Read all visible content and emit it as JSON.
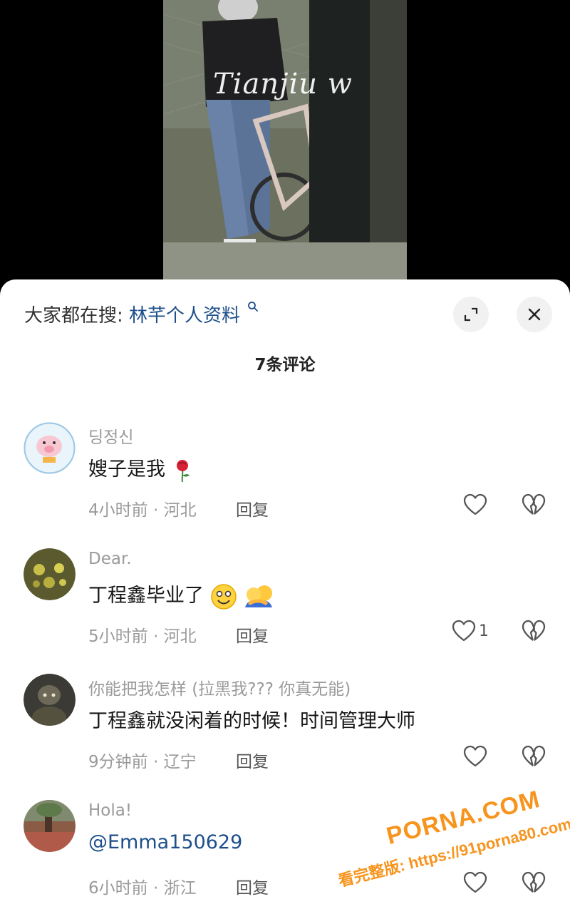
{
  "video": {
    "watermark": "Tianjiu w"
  },
  "sheet": {
    "search": {
      "prefix": "大家都在搜:",
      "query": "林芊个人资料"
    },
    "count_label": "7条评论",
    "reply_label": "回复",
    "comments": [
      {
        "username": "딩정신",
        "text": "嫂子是我",
        "emoji": "rose",
        "time": "4小时前 · 河北",
        "likes": ""
      },
      {
        "username": "Dear.",
        "text": "丁程鑫毕业了",
        "emoji": "smile, hug",
        "time": "5小时前 · 河北",
        "likes": "1"
      },
      {
        "username": "你能把我怎样 (拉黑我??? 你真无能)",
        "text": "丁程鑫就没闲着的时候！时间管理大师",
        "time": "9分钟前 · 辽宁",
        "likes": ""
      },
      {
        "username": "Hola!",
        "text": "@Emma150629",
        "time": "6小时前 · 浙江",
        "likes": ""
      }
    ]
  },
  "site_watermark": {
    "line1": "PORNA.COM",
    "line2": "看完整版: https://91porna80.com"
  },
  "colors": {
    "link": "#1d4f8a",
    "muted": "#9a9a9a",
    "watermark": "#f7941d"
  }
}
